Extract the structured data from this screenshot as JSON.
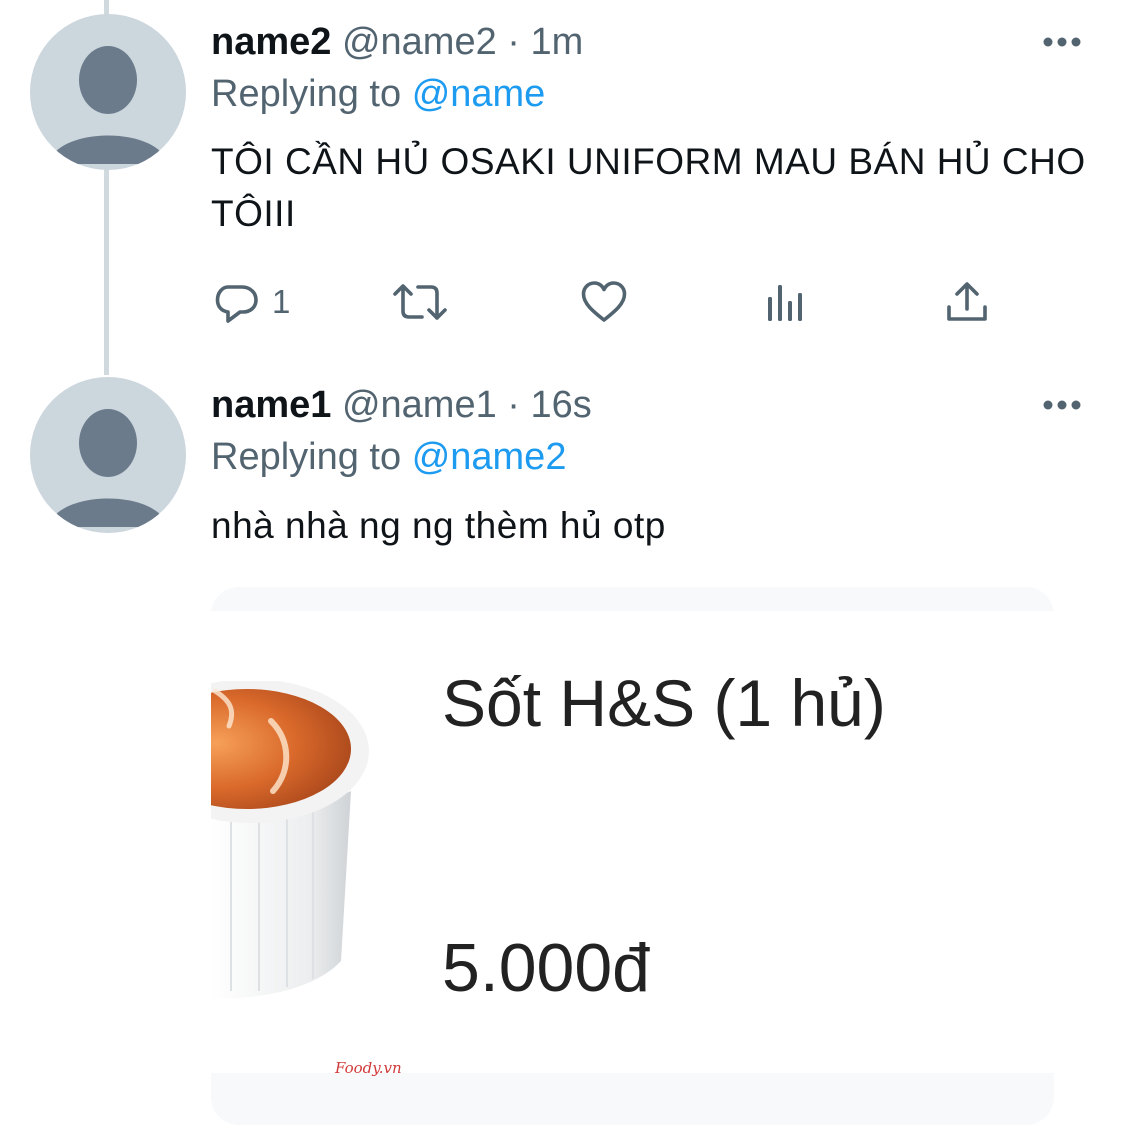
{
  "tweets": [
    {
      "name": "name2",
      "handle": "@name2",
      "sep": "·",
      "time": "1m",
      "replying_prefix": "Replying to",
      "replying_to": "@name",
      "text": "TÔI CẦN HỦ OSAKI UNIFORM MAU BÁN HỦ CHO TÔIII",
      "actions": {
        "reply_count": "1",
        "reply_icon": "reply-icon",
        "retweet_icon": "retweet-icon",
        "like_icon": "heart-icon",
        "analytics_icon": "analytics-icon",
        "share_icon": "share-icon"
      }
    },
    {
      "name": "name1",
      "handle": "@name1",
      "sep": "·",
      "time": "16s",
      "replying_prefix": "Replying to",
      "replying_to": "@name2",
      "text": "nhà nhà ng ng thèm hủ otp",
      "media": {
        "title": "Sốt H&S (1 hủ)",
        "price": "5.000đ",
        "watermark": "Foody.vn"
      }
    }
  ],
  "colors": {
    "link": "#1d9bf0",
    "secondary": "#536471",
    "avatar_bg": "#ccd6dd",
    "avatar_fg": "#6b7b8c"
  }
}
